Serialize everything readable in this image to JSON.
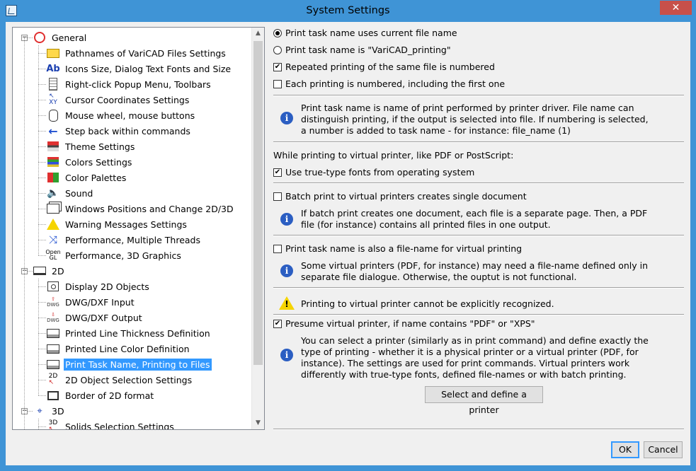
{
  "window": {
    "title": "System Settings",
    "close_glyph": "✕"
  },
  "tree": {
    "items": [
      {
        "label": "General",
        "icon": "general-circle-icon",
        "level": 0,
        "expander": "−"
      },
      {
        "label": "Pathnames of VariCAD Files Settings",
        "icon": "folder-icon",
        "level": 1
      },
      {
        "label": "Icons Size, Dialog Text Fonts and Size",
        "icon": "font-ab-icon",
        "level": 1
      },
      {
        "label": "Right-click Popup Menu, Toolbars",
        "icon": "popup-menu-icon",
        "level": 1
      },
      {
        "label": "Cursor Coordinates Settings",
        "icon": "cursor-xy-icon",
        "level": 1
      },
      {
        "label": "Mouse wheel, mouse buttons",
        "icon": "mouse-icon",
        "level": 1
      },
      {
        "label": "Step back within commands",
        "icon": "arrow-left-icon",
        "level": 1
      },
      {
        "label": "Theme Settings",
        "icon": "theme-icon",
        "level": 1
      },
      {
        "label": "Colors Settings",
        "icon": "colors-icon",
        "level": 1
      },
      {
        "label": "Color Palettes",
        "icon": "palette-icon",
        "level": 1
      },
      {
        "label": "Sound",
        "icon": "speaker-icon",
        "level": 1
      },
      {
        "label": "Windows Positions and Change 2D/3D",
        "icon": "windows-icon",
        "level": 1
      },
      {
        "label": "Warning Messages Settings",
        "icon": "warning-icon",
        "level": 1
      },
      {
        "label": "Performance, Multiple Threads",
        "icon": "threads-icon",
        "level": 1
      },
      {
        "label": "Performance, 3D Graphics",
        "icon": "opengl-icon",
        "level": 1
      },
      {
        "label": "2D",
        "icon": "2d-frame-icon",
        "level": 0,
        "expander": "−"
      },
      {
        "label": "Display 2D Objects",
        "icon": "display-2d-icon",
        "level": 1
      },
      {
        "label": "DWG/DXF Input",
        "icon": "dwg-input-icon",
        "level": 1
      },
      {
        "label": "DWG/DXF Output",
        "icon": "dwg-output-icon",
        "level": 1
      },
      {
        "label": "Printed Line Thickness Definition",
        "icon": "printer-icon",
        "level": 1
      },
      {
        "label": "Printed Line Color Definition",
        "icon": "printer-color-icon",
        "level": 1
      },
      {
        "label": "Print Task Name, Printing to Files",
        "icon": "printer-file-icon",
        "level": 1,
        "selected": true
      },
      {
        "label": "2D Object Selection Settings",
        "icon": "selection-2d-icon",
        "level": 1
      },
      {
        "label": "Border of 2D format",
        "icon": "border-icon",
        "level": 1
      },
      {
        "label": "3D",
        "icon": "3d-axes-icon",
        "level": 0,
        "expander": "−"
      },
      {
        "label": "Solids Selection Settings",
        "icon": "solids-select-icon",
        "level": 1
      }
    ],
    "icon_text": {
      "ab": "Ab",
      "xy": "XY",
      "opengl_top": "Open",
      "opengl_bottom": "GL",
      "dwg": "DWG",
      "twod": "2D",
      "threed": "3D"
    }
  },
  "panel": {
    "radio_current": "Print task name uses current file name",
    "radio_varicad": "Print task name is \"VariCAD_printing\"",
    "chk_repeated": "Repeated printing of the same file is numbered",
    "chk_each": "Each printing is numbered, including the first one",
    "info1": "Print task name is name of print performed by printer driver. File name can distinguish printing, if the output is selected into file. If numbering is selected, a number is added to task name - for instance: file_name (1)",
    "virtual_heading": "While printing to virtual printer, like PDF or PostScript:",
    "chk_truetype": "Use true-type fonts from operating system",
    "chk_batch": "Batch print to virtual printers creates single document",
    "info2": "If batch print creates one document, each file is a separate page. Then, a PDF file (for instance) contains all printed files in one output.",
    "chk_filename": "Print task name is also a file-name for virtual printing",
    "info3": "Some virtual printers (PDF, for instance) may need a file-name defined only in separate file dialogue. Otherwise, the ouptut is not functional.",
    "warning": "Printing to virtual printer cannot be explicitly recognized.",
    "chk_presume": "Presume virtual printer, if name contains \"PDF\" or \"XPS\"",
    "info4": "You can select a printer (similarly as in print command) and define exactly the type of printing - whether it is a physical printer or a virtual printer (PDF, for instance). The settings are used for print commands. Virtual printers work differently with true-type fonts, defined file-names or with batch printing.",
    "select_printer_button": "Select and define a printer",
    "info_glyph": "i",
    "warn_glyph": "!",
    "check_glyph": "✔"
  },
  "footer": {
    "ok": "OK",
    "cancel": "Cancel"
  },
  "colors": {
    "titlebar": "#3f94d6",
    "close": "#c7504a",
    "selection": "#3399ff"
  }
}
